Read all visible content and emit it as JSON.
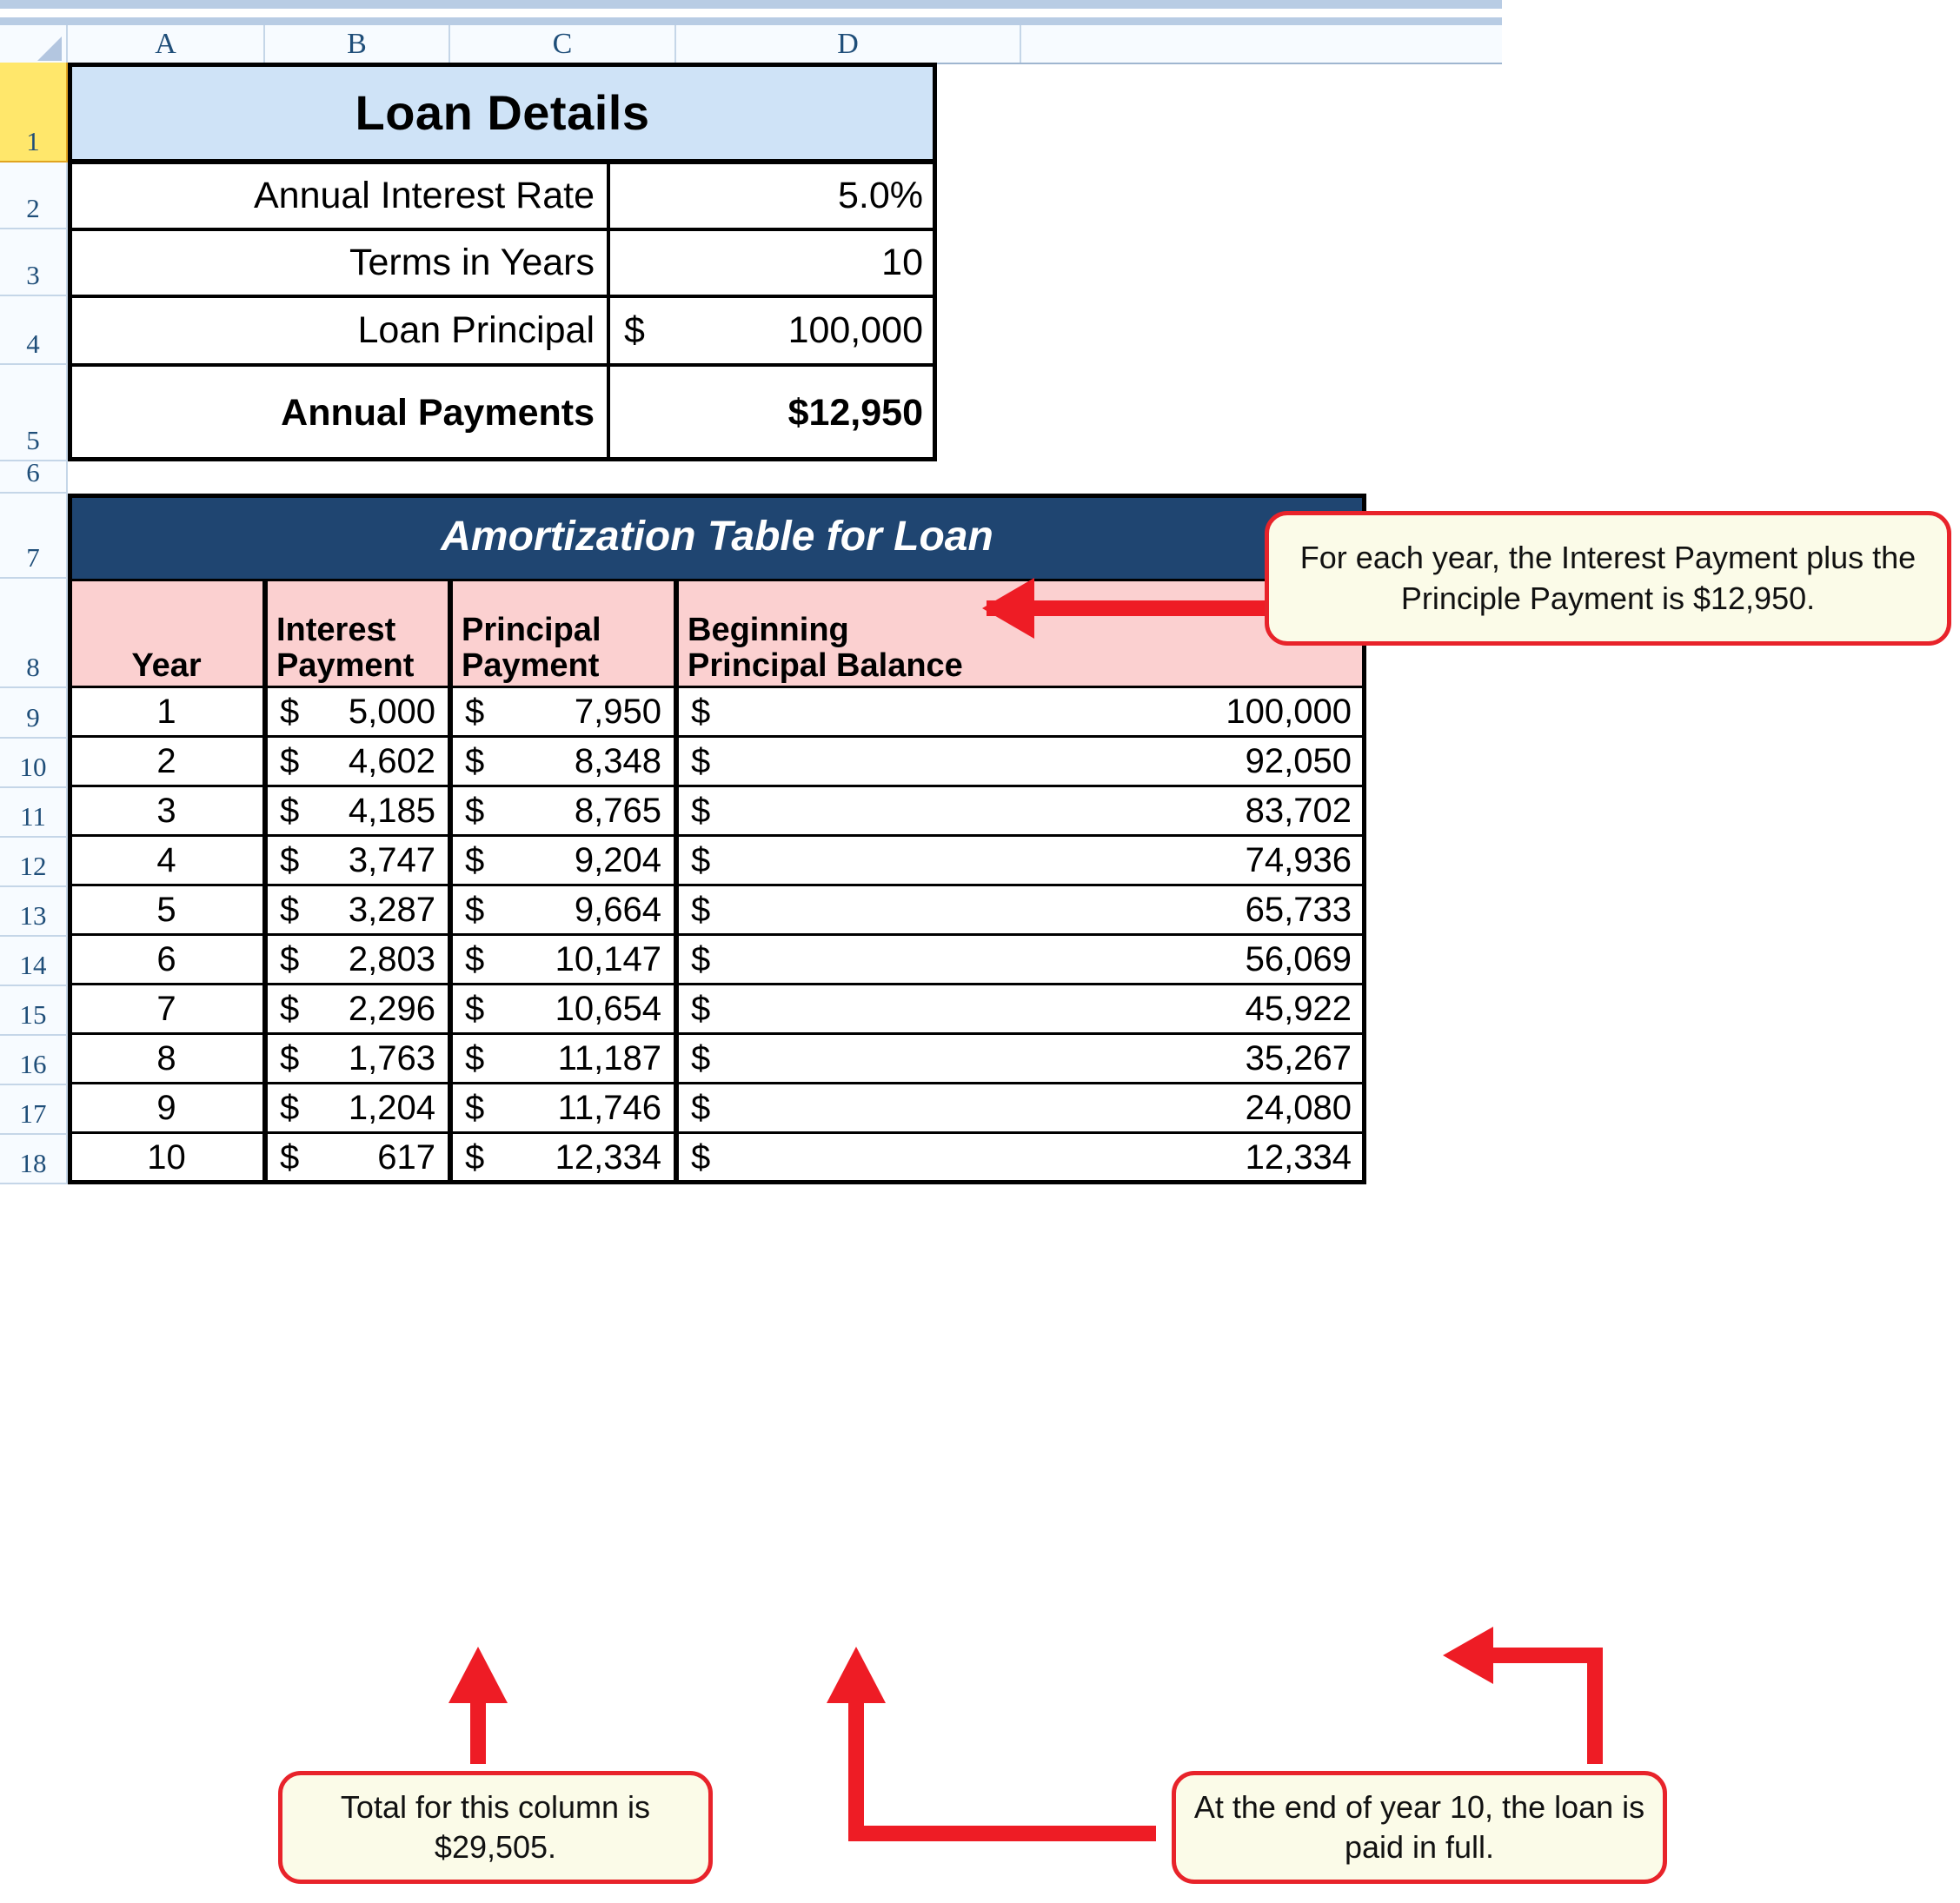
{
  "spreadsheet": {
    "column_headers": [
      "A",
      "B",
      "C",
      "D"
    ],
    "row_headers": [
      "1",
      "2",
      "3",
      "4",
      "5",
      "6",
      "7",
      "8",
      "9",
      "10",
      "11",
      "12",
      "13",
      "14",
      "15",
      "16",
      "17",
      "18"
    ],
    "selected_row": "1"
  },
  "loan_details": {
    "title": "Loan Details",
    "rows": [
      {
        "label": "Annual Interest Rate",
        "value": "5.0%",
        "symbol": ""
      },
      {
        "label": "Terms in Years",
        "value": "10",
        "symbol": ""
      },
      {
        "label": "Loan Principal",
        "value": "100,000",
        "symbol": "$"
      },
      {
        "label": "Annual Payments",
        "value": "$12,950",
        "symbol": ""
      }
    ]
  },
  "amortization": {
    "title": "Amortization Table for Loan",
    "headers": {
      "year": "Year",
      "interest_line1": "Interest",
      "interest_line2": "Payment",
      "principal_line1": "Principal",
      "principal_line2": "Payment",
      "balance_line1": "Beginning",
      "balance_line2": "Principal Balance"
    },
    "currency_symbol": "$",
    "rows": [
      {
        "year": "1",
        "interest": "5,000",
        "principal": "7,950",
        "balance": "100,000"
      },
      {
        "year": "2",
        "interest": "4,602",
        "principal": "8,348",
        "balance": "92,050"
      },
      {
        "year": "3",
        "interest": "4,185",
        "principal": "8,765",
        "balance": "83,702"
      },
      {
        "year": "4",
        "interest": "3,747",
        "principal": "9,204",
        "balance": "74,936"
      },
      {
        "year": "5",
        "interest": "3,287",
        "principal": "9,664",
        "balance": "65,733"
      },
      {
        "year": "6",
        "interest": "2,803",
        "principal": "10,147",
        "balance": "56,069"
      },
      {
        "year": "7",
        "interest": "2,296",
        "principal": "10,654",
        "balance": "45,922"
      },
      {
        "year": "8",
        "interest": "1,763",
        "principal": "11,187",
        "balance": "35,267"
      },
      {
        "year": "9",
        "interest": "1,204",
        "principal": "11,746",
        "balance": "24,080"
      },
      {
        "year": "10",
        "interest": "617",
        "principal": "12,334",
        "balance": "12,334"
      }
    ]
  },
  "callouts": {
    "annual_payment": "For each year, the Interest Payment plus the Principle Payment is $12,950.",
    "interest_total": "Total for this column is $29,505.",
    "paid_in_full": "At the end of year 10, the loan is paid in full."
  },
  "colors": {
    "loan_details_header": "#cfe3f7",
    "amortization_title_bg": "#1f4571",
    "amortization_header_bg": "#fbd0d0",
    "callout_border": "#e8232a",
    "callout_bg": "#fbfbe8",
    "selected_row_header": "#ffe76b",
    "arrow": "#ee1c25"
  }
}
